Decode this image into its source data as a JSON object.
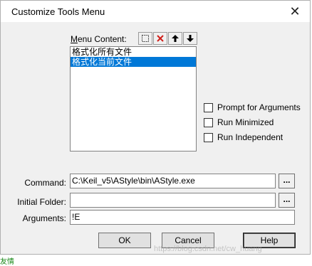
{
  "window": {
    "title": "Customize Tools Menu",
    "close_glyph": "✕"
  },
  "menu_content": {
    "label_prefix": "M",
    "label_rest": "enu Content:",
    "toolbar": [
      {
        "name": "new-item-icon"
      },
      {
        "name": "delete-icon",
        "color": "#d0201a"
      },
      {
        "name": "move-up-icon"
      },
      {
        "name": "move-down-icon"
      }
    ],
    "items": [
      {
        "label": "格式化所有文件",
        "selected": false
      },
      {
        "label": "格式化当前文件",
        "selected": true
      }
    ]
  },
  "options": {
    "prompt_arguments": "Prompt for  Arguments",
    "run_minimized": "Run Minimized",
    "run_independent": "Run Independent"
  },
  "fields": {
    "command_label": "Command:",
    "command_value": "C:\\Keil_v5\\AStyle\\bin\\AStyle.exe",
    "initial_folder_label": "Initial Folder:",
    "initial_folder_value": "",
    "arguments_label": "Arguments:",
    "arguments_value": "!E",
    "browse_label": "..."
  },
  "buttons": {
    "ok": "OK",
    "cancel": "Cancel",
    "help": "Help"
  },
  "watermark": "https://blog.csdn.net/cw_huang",
  "bottom_fragment": "友情",
  "colors": {
    "selection": "#0078d7",
    "dialog_bg": "#f0f0f0"
  }
}
